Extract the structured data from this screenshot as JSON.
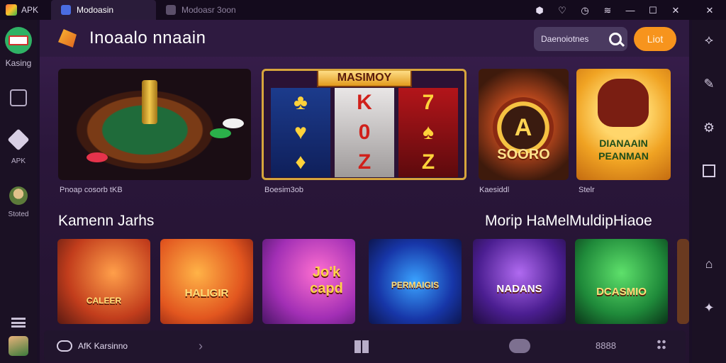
{
  "titlebar": {
    "brand": "APK",
    "tabs": [
      {
        "label": "Modoasin"
      },
      {
        "label": "Modoasr 3oon"
      }
    ],
    "icons": [
      "bag-icon",
      "heart-icon",
      "clock-icon",
      "wifi-icon",
      "minimize-icon",
      "maximize-icon",
      "close-icon",
      "close-icon"
    ]
  },
  "sidebar": {
    "items": [
      {
        "label": "Kasing"
      },
      {
        "label": "APK"
      },
      {
        "label": "Stoted"
      }
    ]
  },
  "header": {
    "title": "Inoaalo nnaain",
    "search_placeholder": "Daenoiotnes",
    "list_label": "Liot"
  },
  "featured": [
    {
      "caption": "Pnoap cosorb tKB"
    },
    {
      "caption": "Boesim3ob",
      "banner": "MASIMOY",
      "symbols": [
        "K",
        "0",
        "Z"
      ]
    },
    {
      "caption": "Kaesiddl",
      "symbol": "A",
      "label": "SOORO"
    },
    {
      "caption": "Stelr",
      "label": "DIANAAIN PEANMAN"
    }
  ],
  "sections": {
    "left_title": "Kamenn Jarhs",
    "right_title": "Morip HaMelMuldipHiaoe"
  },
  "games": [
    {
      "title": "CALEER"
    },
    {
      "title": "HALIGIR"
    },
    {
      "title": "Jo'k capd"
    },
    {
      "title": "PERMAIGIS"
    },
    {
      "title": "NADANS"
    },
    {
      "title": "DCASMIO"
    }
  ],
  "bottombar": {
    "label": "AfK Karsinno",
    "count": "8888"
  }
}
